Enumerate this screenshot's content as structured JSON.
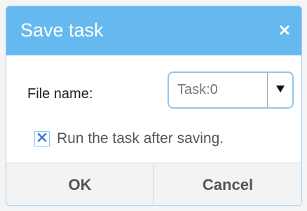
{
  "dialog": {
    "title": "Save task",
    "close_icon": "close-icon"
  },
  "form": {
    "file_name_label": "File name:",
    "file_name_value": "Task:0",
    "dropdown_icon": "chevron-down-icon"
  },
  "option": {
    "checked": true,
    "label": "Run the task after saving."
  },
  "actions": {
    "ok_label": "OK",
    "cancel_label": "Cancel"
  },
  "colors": {
    "titlebar": "#66b9ee",
    "accent": "#2f7ed8",
    "button_bg": "#f3f3f3"
  }
}
